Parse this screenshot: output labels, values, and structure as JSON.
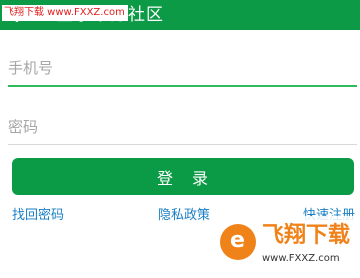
{
  "header": {
    "title": "登录来分社区",
    "back_icon": "arrow-left-icon",
    "background_color": "#0c9a47"
  },
  "watermark_top": {
    "text": "飞翔下载 www.FXXZ.com"
  },
  "form": {
    "phone_placeholder": "手机号",
    "phone_value": "",
    "password_placeholder": "密码",
    "password_value": "",
    "login_button_label": "登 录",
    "button_color": "#0b9a45"
  },
  "links": {
    "forgot_password": "找回密码",
    "privacy_policy": "隐私政策",
    "quick_register": "快速注册",
    "link_color": "#1a7fc4"
  },
  "watermark_bottom": {
    "title": "飞翔下载",
    "url": "www.FXXZ.com"
  }
}
